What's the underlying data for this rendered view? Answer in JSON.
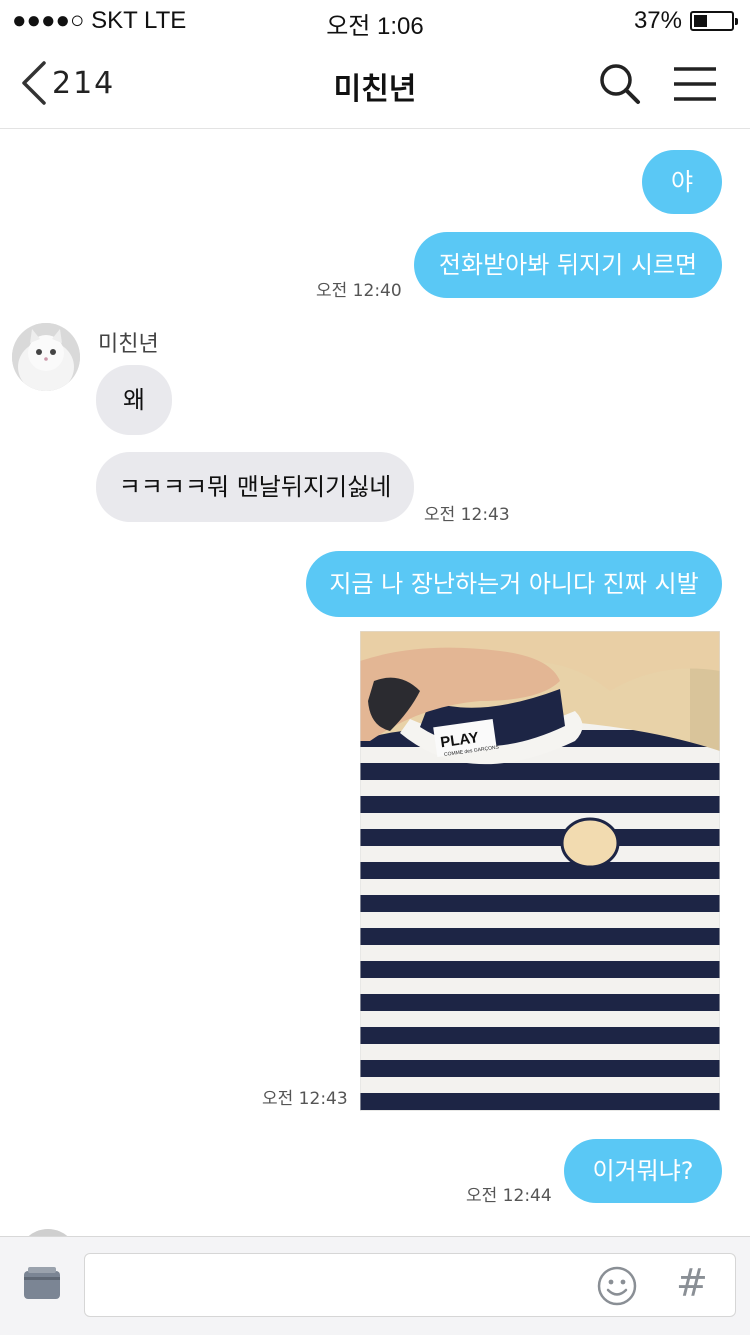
{
  "status_bar": {
    "carrier": "●●●●○ SKT   LTE",
    "time": "오전 1:06",
    "battery": "37%",
    "battery_level": 0.37
  },
  "nav": {
    "back_count": "214",
    "title": "미친년",
    "back_icon": "chevron-left-icon",
    "search_icon": "search-icon",
    "menu_icon": "hamburger-menu-icon"
  },
  "messages": [
    {
      "from": "me",
      "text": "야"
    },
    {
      "from": "me",
      "text": "전화받아봐 뒤지기 시르면",
      "time": "오전 12:40"
    },
    {
      "from": "other",
      "sender": "미친년",
      "text": "왜"
    },
    {
      "from": "other",
      "text": "ㅋㅋㅋㅋ뭐 맨날뒤지기싫네",
      "time": "오전 12:43"
    },
    {
      "from": "me",
      "text": "지금 나 장난하는거 아니다 진짜 시발"
    },
    {
      "from": "me",
      "type": "photo",
      "photo_label": "PLAY",
      "photo_sublabel": "COMME des GARÇONS",
      "time": "오전 12:43"
    },
    {
      "from": "me",
      "text": "이거뭐냐?",
      "time": "오전 12:44"
    }
  ],
  "input_bar": {
    "attach_icon": "folder-icon",
    "emoji_icon": "smiley-icon",
    "hash_label": "#"
  },
  "colors": {
    "outgoing_bubble": "#5ac8f5",
    "incoming_bubble": "#e9e9ed",
    "background": "#ffffff"
  }
}
